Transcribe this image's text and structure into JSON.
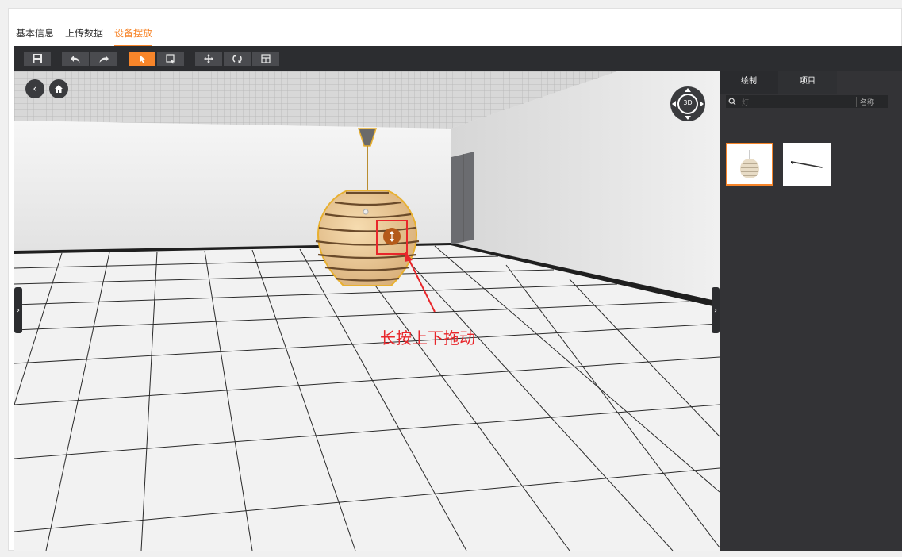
{
  "tabs": [
    {
      "label": "基本信息",
      "active": false
    },
    {
      "label": "上传数据",
      "active": false
    },
    {
      "label": "设备摆放",
      "active": true
    }
  ],
  "toolbar": {
    "buttons": [
      {
        "icon": "save-icon",
        "active": false
      },
      {
        "icon": "undo-icon",
        "active": false
      },
      {
        "icon": "redo-icon",
        "active": false
      },
      {
        "icon": "pointer-icon",
        "active": true
      },
      {
        "icon": "box-select-icon",
        "active": false
      },
      {
        "icon": "move-icon",
        "active": false
      },
      {
        "icon": "rotate-icon",
        "active": false
      },
      {
        "icon": "layout-icon",
        "active": false
      }
    ]
  },
  "viewport": {
    "compass_label": "3D",
    "annotation": "长按上下拖动"
  },
  "panel": {
    "tabs": [
      "绘制",
      "项目"
    ],
    "search_placeholder": "灯",
    "search_field": "名称",
    "items": [
      {
        "icon": "pendant-lamp-icon",
        "selected": true
      },
      {
        "icon": "linear-light-icon",
        "selected": false
      }
    ]
  },
  "colors": {
    "accent": "#f7852a",
    "toolbar_bg": "#2c2d30",
    "panel_bg": "#333336",
    "annotation": "#e8262b"
  }
}
